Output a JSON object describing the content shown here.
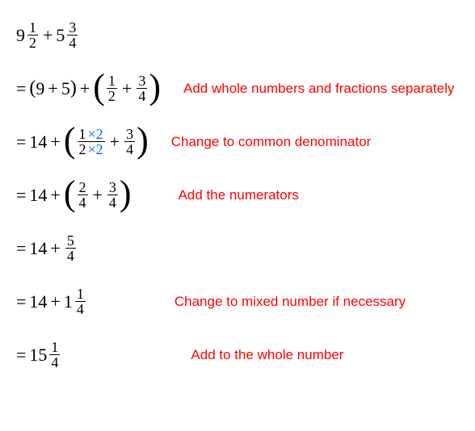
{
  "line1": {
    "w1": "9",
    "n1": "1",
    "d1": "2",
    "op": "+",
    "w2": "5",
    "n2": "3",
    "d2": "4"
  },
  "line2": {
    "eq": "=",
    "lp1": "(",
    "a": "9",
    "op1": "+",
    "b": "5",
    "rp1": ")",
    "op2": "+",
    "lp2": "(",
    "n1": "1",
    "d1": "2",
    "op3": "+",
    "n2": "3",
    "d2": "4",
    "rp2": ")",
    "note": "Add whole numbers and fractions separately"
  },
  "line3": {
    "eq": "=",
    "a": "14",
    "op1": "+",
    "lp": "(",
    "n1": "1",
    "m1": "×2",
    "d1": "2",
    "m2": "×2",
    "op2": "+",
    "n2": "3",
    "d2": "4",
    "rp": ")",
    "note": "Change to common denominator"
  },
  "line4": {
    "eq": "=",
    "a": "14",
    "op1": "+",
    "lp": "(",
    "n1": "2",
    "d1": "4",
    "op2": "+",
    "n2": "3",
    "d2": "4",
    "rp": ")",
    "note": "Add the numerators"
  },
  "line5": {
    "eq": "=",
    "a": "14",
    "op1": "+",
    "n1": "5",
    "d1": "4"
  },
  "line6": {
    "eq": "=",
    "a": "14",
    "op1": "+",
    "w": "1",
    "n1": "1",
    "d1": "4",
    "note": "Change to mixed number if necessary"
  },
  "line7": {
    "eq": "=",
    "w": "15",
    "n1": "1",
    "d1": "4",
    "note": "Add to the whole number"
  }
}
